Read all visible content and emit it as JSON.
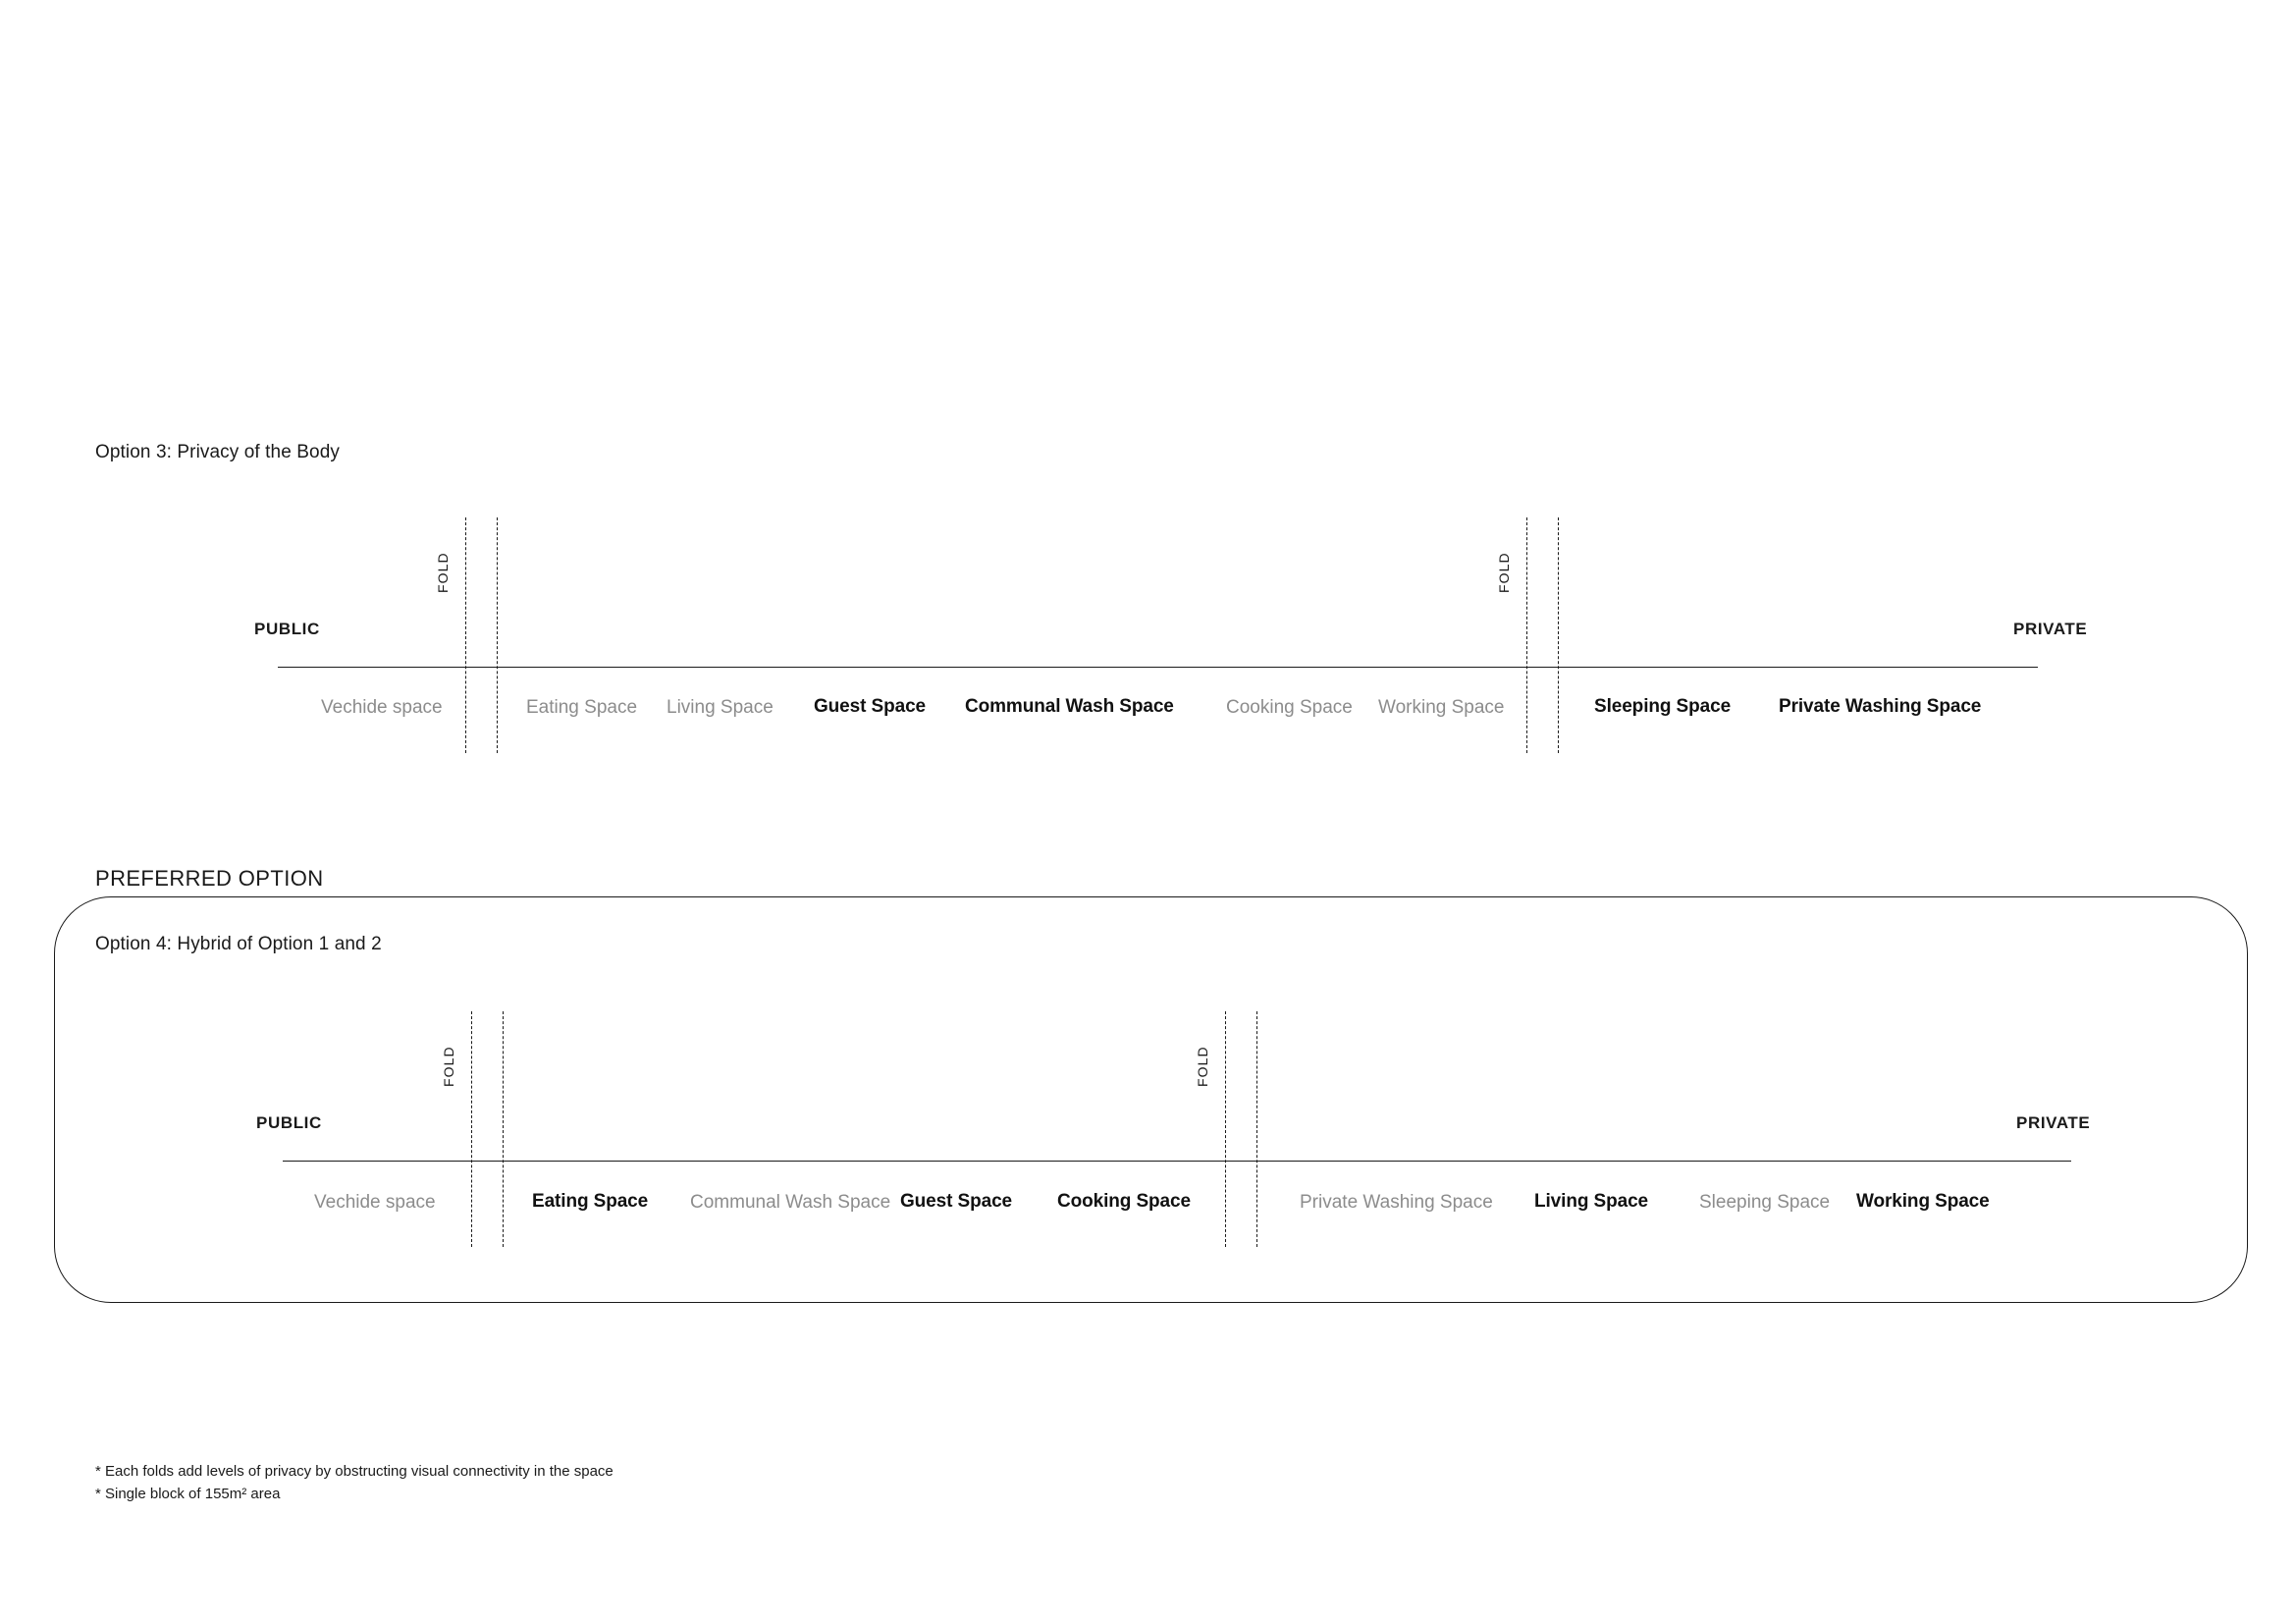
{
  "page": {
    "background": "#ffffff",
    "text_color": "#1a1a1a",
    "muted_color": "#8c8c8c"
  },
  "option3": {
    "title": "Option 3: Privacy of the Body",
    "public_label": "PUBLIC",
    "private_label": "PRIVATE",
    "fold_label_1": "FOLD",
    "fold_label_2": "FOLD",
    "spaces": [
      {
        "label": "Vechide space",
        "emphasis": "soft"
      },
      {
        "label": "Eating Space",
        "emphasis": "soft"
      },
      {
        "label": "Living Space",
        "emphasis": "soft"
      },
      {
        "label": "Guest Space",
        "emphasis": "strong"
      },
      {
        "label": "Communal Wash Space",
        "emphasis": "strong"
      },
      {
        "label": "Cooking Space",
        "emphasis": "soft"
      },
      {
        "label": "Working Space",
        "emphasis": "soft"
      },
      {
        "label": "Sleeping Space",
        "emphasis": "strong"
      },
      {
        "label": "Private Washing Space",
        "emphasis": "strong"
      }
    ]
  },
  "preferred": {
    "banner": "PREFERRED OPTION",
    "title": "Option 4: Hybrid of Option 1 and 2",
    "public_label": "PUBLIC",
    "private_label": "PRIVATE",
    "fold_label_1": "FOLD",
    "fold_label_2": "FOLD",
    "spaces": [
      {
        "label": "Vechide space",
        "emphasis": "soft"
      },
      {
        "label": "Eating Space",
        "emphasis": "strong"
      },
      {
        "label": "Communal Wash Space",
        "emphasis": "soft"
      },
      {
        "label": "Guest Space",
        "emphasis": "strong"
      },
      {
        "label": "Cooking Space",
        "emphasis": "strong"
      },
      {
        "label": "Private Washing Space",
        "emphasis": "soft"
      },
      {
        "label": "Living Space",
        "emphasis": "strong"
      },
      {
        "label": "Sleeping Space",
        "emphasis": "soft"
      },
      {
        "label": "Working Space",
        "emphasis": "strong"
      }
    ]
  },
  "footnotes": [
    "* Each folds add levels of privacy by obstructing visual connectivity in the space",
    "* Single block of 155m² area"
  ]
}
